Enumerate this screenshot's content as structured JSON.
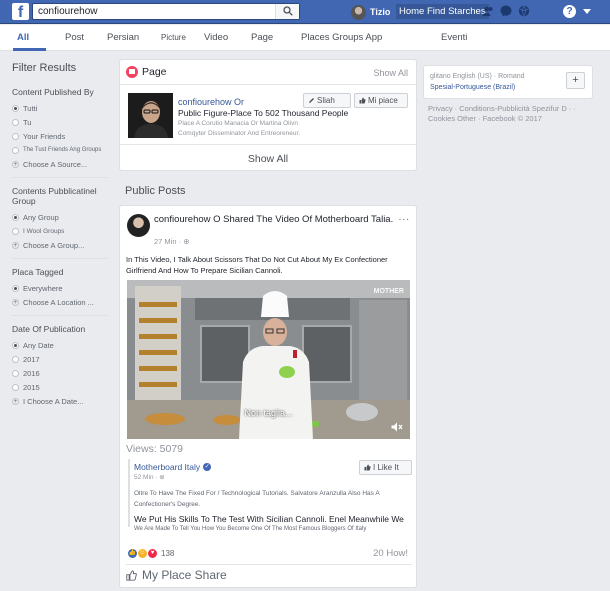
{
  "topbar": {
    "logo": "f",
    "search_value": "confiourehow",
    "user_name": "Tizio",
    "nav_link": "Home Find Starches",
    "help": "?"
  },
  "tabs": [
    "All",
    "Post",
    "Persian",
    "Picture",
    "Video",
    "Page",
    "Places Groups App",
    "Eventi"
  ],
  "sidebar": {
    "title": "Filter Results",
    "published_by": {
      "title": "Content Published By",
      "options": [
        "Tutti",
        "Tu",
        "Your Friends",
        "The Tust Friends Ang Groups"
      ],
      "choose": "Choose A Source..."
    },
    "group": {
      "title": "Contents Pubblicatinel Group",
      "options": [
        "Any Group",
        "I Wool Groups"
      ],
      "choose": "Choose A Group..."
    },
    "tagged": {
      "title": "Placa Tagged",
      "options": [
        "Everywhere"
      ],
      "choose": "Choose A Location ..."
    },
    "date": {
      "title": "Date Of Publication",
      "options": [
        "Any Date",
        "2017",
        "2016",
        "2015"
      ],
      "choose": "I Choose A Date..."
    }
  },
  "page_card": {
    "header": "Page",
    "show_all_top": "Show All",
    "name": "confiourehow Or",
    "description": "Public Figure-Place To 502 Thousand People",
    "meta1": "Place A Corutio Manacia Or Martina Olivn",
    "meta2": "Comqyter Disseminator And Entreoreneur.",
    "follow_label": "Sliah",
    "like_label": "Mi piace",
    "show_all_bottom": "Show All"
  },
  "section_title": "Public Posts",
  "post": {
    "header": "confiourehow O Shared The Video Of Motherboard Talia.",
    "time": "27 Min",
    "more": "...",
    "text": "In This Video, I Talk About Scissors That Do Not Cut About My Ex Confectioner Girlfriend And How To Prepare Sicilian Cannoli.",
    "video_brand": "MOTHER",
    "caption": "Non taglia...",
    "views": "Views: 5079",
    "shared": {
      "name": "Motherboard Italy",
      "verified": "✓",
      "time": "52 Min",
      "like_label": "I Like It",
      "text1": "Oltre To Have The Fixed For / Technological Tutorials. Salvatore Aranzulla Also Has A Confectioner's Degree.",
      "text2": "We Put His Skills To The Test With Sicilian Cannoli. Enel Meanwhile We",
      "text3": "We Are Made To Tell You How You Become One Of The Most Famous Bloggers Of Italy"
    },
    "reaction_count": "138",
    "comments_count": "20 How!",
    "actions": "My Place Share"
  },
  "right": {
    "lang1": "glitano English (US) · Romand",
    "lang2": "Spesial-Portuguese (Brazil)",
    "plus": "+",
    "footer": "Privacy · Conditions-Pubblicità Spezifur D · · Cookies Other · Facebook © 2017"
  },
  "colors": {
    "topbar": "#4267b2",
    "link": "#365899",
    "background": "#e9ebee"
  }
}
